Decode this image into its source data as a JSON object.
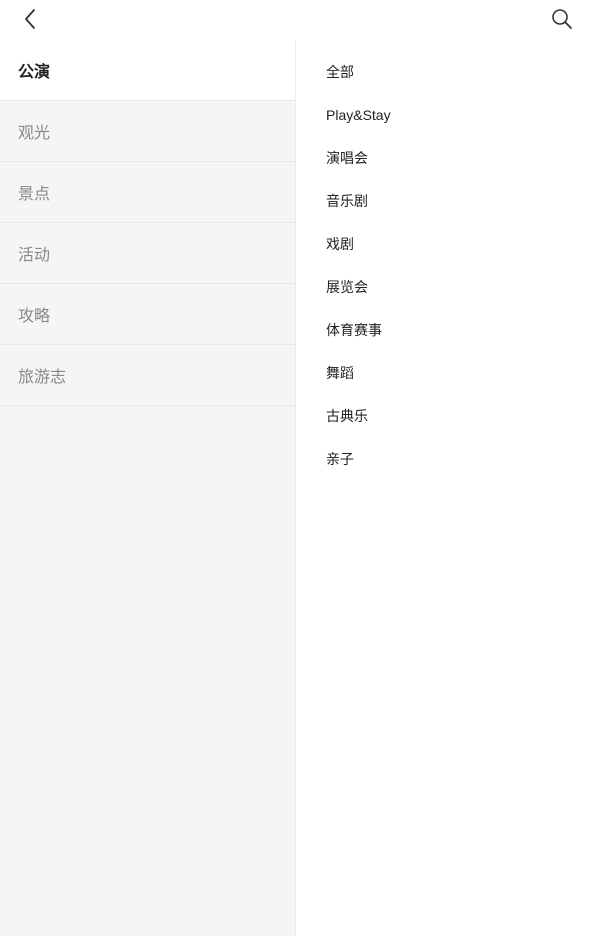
{
  "header": {
    "back_icon": "chevron-left-icon",
    "search_icon": "search-icon"
  },
  "categories": [
    {
      "label": "公演",
      "active": true
    },
    {
      "label": "观光",
      "active": false
    },
    {
      "label": "景点",
      "active": false
    },
    {
      "label": "活动",
      "active": false
    },
    {
      "label": "攻略",
      "active": false
    },
    {
      "label": "旅游志",
      "active": false
    }
  ],
  "subcategories": [
    {
      "label": "全部"
    },
    {
      "label": "Play&Stay"
    },
    {
      "label": "演唱会"
    },
    {
      "label": "音乐剧"
    },
    {
      "label": "戏剧"
    },
    {
      "label": "展览会"
    },
    {
      "label": "体育赛事"
    },
    {
      "label": "舞蹈"
    },
    {
      "label": "古典乐"
    },
    {
      "label": "亲子"
    }
  ],
  "colors": {
    "sidebar_bg": "#f5f5f5",
    "active_text": "#222222",
    "inactive_text": "#888888"
  }
}
